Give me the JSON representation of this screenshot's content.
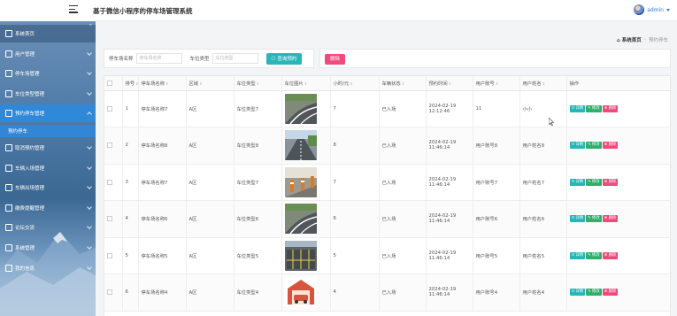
{
  "header": {
    "title": "基于微信小程序的停车场管理系统",
    "user": "admin"
  },
  "sidebar": {
    "items": [
      {
        "label": "系统首页",
        "icon": "home-icon"
      },
      {
        "label": "用户管理",
        "icon": "user-icon"
      },
      {
        "label": "停车场管理",
        "icon": "parking-icon"
      },
      {
        "label": "车位类型管理",
        "icon": "list-icon"
      },
      {
        "label": "预约停车管理",
        "icon": "calendar-icon",
        "active": true
      },
      {
        "label": "取消预约管理",
        "icon": "cancel-icon"
      },
      {
        "label": "车辆入场管理",
        "icon": "car-in-icon"
      },
      {
        "label": "车辆出场管理",
        "icon": "car-out-icon"
      },
      {
        "label": "缴费提醒管理",
        "icon": "bell-icon"
      },
      {
        "label": "论坛交流",
        "icon": "forum-icon"
      },
      {
        "label": "系统管理",
        "icon": "settings-icon"
      },
      {
        "label": "我的信息",
        "icon": "profile-icon"
      }
    ],
    "sub_active": "预约停车"
  },
  "breadcrumb": {
    "home": "系统首页",
    "current": "预约停车"
  },
  "search": {
    "label1": "停车场名称",
    "placeholder1": "停车场名称",
    "label2": "车位类型",
    "placeholder2": "车位类型",
    "button": "查询预约"
  },
  "actions": {
    "delete": "删除"
  },
  "table": {
    "columns": [
      "",
      "排号",
      "停车场名称",
      "区域",
      "车位类型",
      "车位图片",
      "小时/元",
      "车辆状态",
      "预约时间",
      "用户账号",
      "用户姓名",
      "操作"
    ],
    "op_labels": {
      "detail": "详情",
      "edit": "修改",
      "delete": "删除"
    },
    "rows": [
      {
        "no": "1",
        "name": "停车场名称7",
        "area": "A区",
        "type": "车位类型7",
        "price": "7",
        "status": "已入场",
        "time": "2024-02-19 12:12:46",
        "account": "11",
        "username": "小小",
        "img": "curve"
      },
      {
        "no": "2",
        "name": "停车场名称8",
        "area": "A区",
        "type": "车位类型8",
        "price": "8",
        "status": "已入场",
        "time": "2024-02-19 11:46:14",
        "account": "用户账号8",
        "username": "用户姓名8",
        "img": "street"
      },
      {
        "no": "3",
        "name": "停车场名称7",
        "area": "A区",
        "type": "车位类型7",
        "price": "7",
        "status": "已入场",
        "time": "2024-02-19 11:46:14",
        "account": "用户账号7",
        "username": "用户姓名7",
        "img": "barrier"
      },
      {
        "no": "4",
        "name": "停车场名称6",
        "area": "A区",
        "type": "车位类型6",
        "price": "6",
        "status": "已入场",
        "time": "2024-02-19 11:46:14",
        "account": "用户账号6",
        "username": "用户姓名6",
        "img": "curve"
      },
      {
        "no": "5",
        "name": "停车场名称5",
        "area": "A区",
        "type": "车位类型5",
        "price": "5",
        "status": "已入场",
        "time": "2024-02-19 11:46:14",
        "account": "用户账号5",
        "username": "用户姓名5",
        "img": "lot"
      },
      {
        "no": "6",
        "name": "停车场名称4",
        "area": "A区",
        "type": "车位类型4",
        "price": "4",
        "status": "已入场",
        "time": "2024-02-19 11:46:14",
        "account": "用户账号4",
        "username": "用户姓名4",
        "img": "garage"
      }
    ]
  },
  "colors": {
    "accent": "#2f88d8",
    "search_button": "#2bb5ba",
    "delete_button": "#ef4b7d",
    "detail": "#25b6b6",
    "edit": "#2fae6c"
  }
}
